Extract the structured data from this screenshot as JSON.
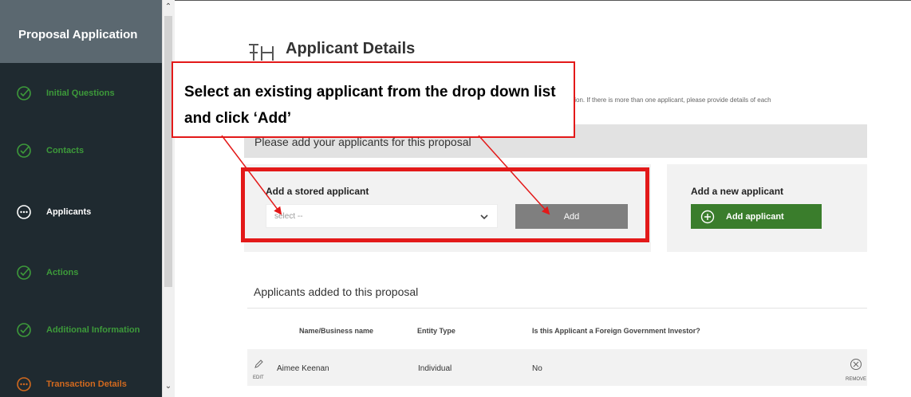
{
  "sidebar": {
    "header": "Proposal Application",
    "items": [
      {
        "label": "Initial Questions",
        "status": "complete",
        "icon": "check-circle-icon"
      },
      {
        "label": "Contacts",
        "status": "complete",
        "icon": "check-circle-icon"
      },
      {
        "label": "Applicants",
        "status": "current",
        "icon": "dots-circle-icon"
      },
      {
        "label": "Actions",
        "status": "complete",
        "icon": "check-circle-icon"
      },
      {
        "label": "Additional Information",
        "status": "complete",
        "icon": "check-circle-icon"
      },
      {
        "label": "Transaction Details",
        "status": "in-progress",
        "icon": "dots-circle-icon"
      }
    ]
  },
  "main": {
    "title": "Applicant Details",
    "intro_text": "tion. If there is more than one applicant, please provide details of each",
    "banner": "Please add your applicants for this proposal",
    "stored": {
      "label": "Add a stored applicant",
      "select_value": "select --",
      "add_button": "Add"
    },
    "new": {
      "label": "Add a new applicant",
      "button": "Add applicant"
    },
    "added_section_title": "Applicants added to this proposal",
    "table": {
      "headers": [
        "Name/Business name",
        "Entity Type",
        "Is this Applicant a Foreign Government Investor?"
      ],
      "rows": [
        {
          "edit": "EDIT",
          "name": "Aimee Keenan",
          "entity_type": "Individual",
          "fgi": "No",
          "remove": "REMOVE"
        }
      ]
    }
  },
  "callout": {
    "text": "Select an existing applicant from the drop down list and click ‘Add’"
  },
  "colors": {
    "sidebar_bg": "#1f2a30",
    "sidebar_header_bg": "#5b6870",
    "complete_green": "#3d9a3a",
    "in_progress_orange": "#d2691e",
    "primary_button_green": "#3a7d2c",
    "add_button_grey": "#7f7f7f",
    "annotation_red": "#e31919"
  }
}
